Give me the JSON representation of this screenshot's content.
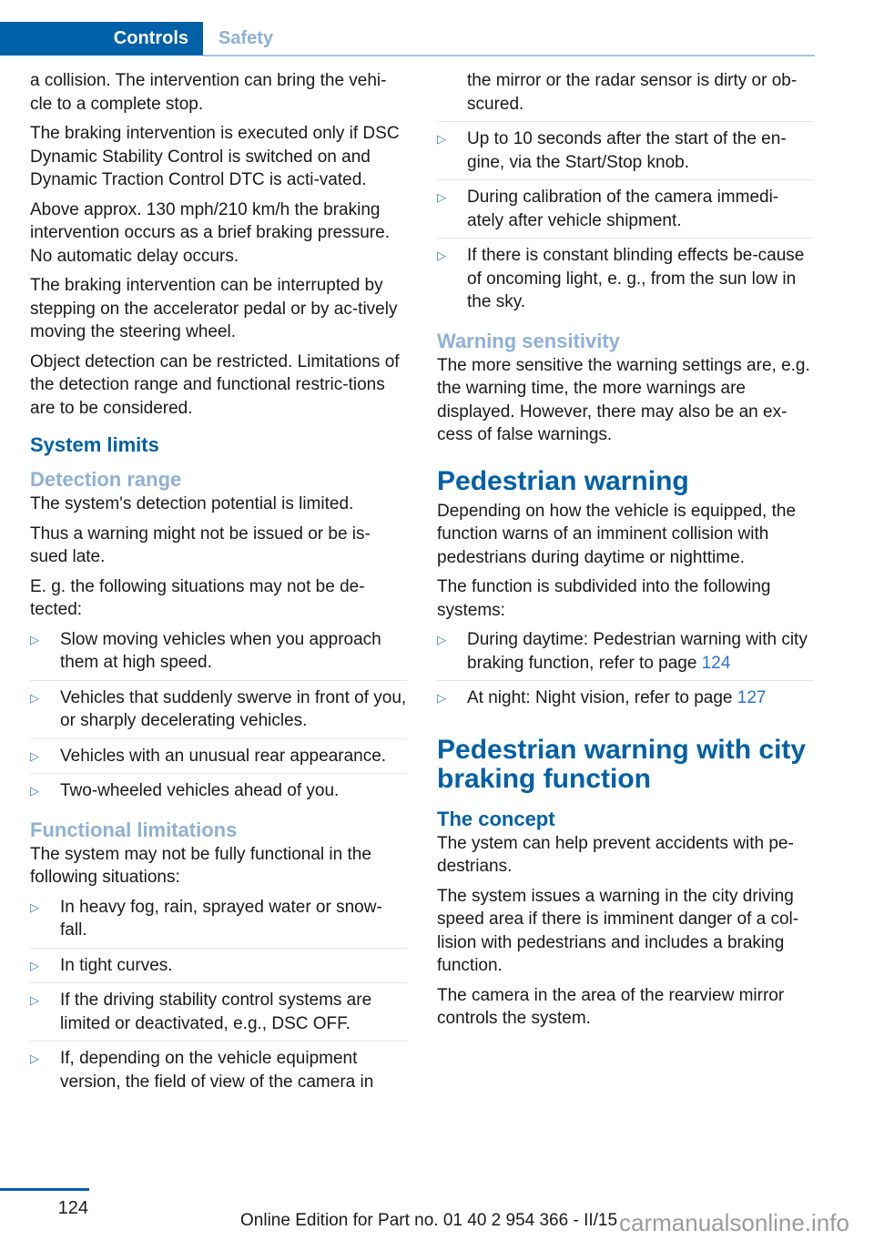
{
  "header": {
    "tab_active": "Controls",
    "tab_inactive": "Safety"
  },
  "left": {
    "p1": "a collision. The intervention can bring the vehi-cle to a complete stop.",
    "p2": "The braking intervention is executed only if DSC Dynamic Stability Control is switched on and Dynamic Traction Control DTC is acti-vated.",
    "p3": "Above approx. 130 mph/210 km/h the braking intervention occurs as a brief braking pressure. No automatic delay occurs.",
    "p4": "The braking intervention can be interrupted by stepping on the accelerator pedal or by ac-tively moving the steering wheel.",
    "p5": "Object detection can be restricted. Limitations of the detection range and functional restric-tions are to be considered.",
    "h_system_limits": "System limits",
    "h_detection_range": "Detection range",
    "p6": "The system's detection potential is limited.",
    "p7": "Thus a warning might not be issued or be is-sued late.",
    "p8": "E. g. the following situations may not be de-tected:",
    "list1": [
      "Slow moving vehicles when you approach them at high speed.",
      "Vehicles that suddenly swerve in front of you, or sharply decelerating vehicles.",
      "Vehicles with an unusual rear appearance.",
      "Two-wheeled vehicles ahead of you."
    ],
    "h_functional": "Functional limitations",
    "p9": "The system may not be fully functional in the following situations:",
    "list2": [
      "In heavy fog, rain, sprayed water or snow-fall.",
      "In tight curves.",
      "If the driving stability control systems are limited or deactivated, e.g., DSC OFF.",
      "If, depending on the vehicle equipment version, the field of view of the camera in"
    ]
  },
  "right": {
    "list_cont": "the mirror or the radar sensor is dirty or ob-scured.",
    "list3": [
      "Up to 10 seconds after the start of the en-gine, via the Start/Stop knob.",
      "During calibration of the camera immedi-ately after vehicle shipment.",
      "If there is constant blinding effects be-cause of oncoming light, e. g., from the sun low in the sky."
    ],
    "h_warning_sens": "Warning sensitivity",
    "p1": "The more sensitive the warning settings are, e.g. the warning time, the more warnings are displayed. However, there may also be an ex-cess of false warnings.",
    "h_ped_warning": "Pedestrian warning",
    "p2": "Depending on how the vehicle is equipped, the function warns of an imminent collision with pedestrians during daytime or nighttime.",
    "p3": "The function is subdivided into the following systems:",
    "list4": [
      {
        "text": "During daytime: Pedestrian warning with city braking function, refer to page ",
        "page": "124"
      },
      {
        "text": "At night: Night vision, refer to page ",
        "page": "127"
      }
    ],
    "h_ped_city": "Pedestrian warning with city braking function",
    "h_concept": "The concept",
    "p4": "The ystem can help prevent accidents with pe-destrians.",
    "p5": "The system issues a warning in the city driving speed area if there is imminent danger of a col-lision with pedestrians and includes a braking function.",
    "p6": "The camera in the area of the rearview mirror controls the system."
  },
  "footer": {
    "page_number": "124",
    "edition": "Online Edition for Part no. 01 40 2 954 366 - II/15",
    "watermark": "carmanualsonline.info"
  },
  "icons": {
    "bullet": "▷"
  },
  "colors": {
    "brand_blue": "#0060a8",
    "light_blue": "#8fb0d8",
    "link_blue": "#2a72d6"
  }
}
